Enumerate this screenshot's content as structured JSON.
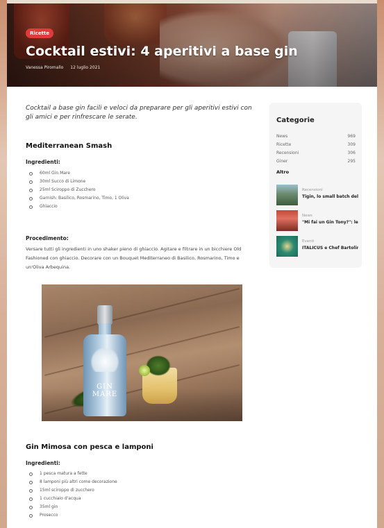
{
  "hero": {
    "tag": "Ricette",
    "title": "Cocktail estivi: 4 aperitivi a base gin",
    "author": "Vanessa Piromallo",
    "date": "12 luglio 2021"
  },
  "article": {
    "intro": "Cocktail a base gin facili e veloci da preparare per gli aperitivi estivi con gli amici e per rinfrescare le serate.",
    "recipes": [
      {
        "title": "Mediterranean Smash",
        "ingredients_label": "Ingredienti:",
        "ingredients": [
          "60ml Gin Mare",
          "30ml Succo di Limone",
          "25ml Sciroppo di Zucchero",
          "Garnish: Basilico, Rosmarino, Timo, 1 Oliva",
          "Ghiaccio"
        ],
        "procedure_label": "Procedimento:",
        "procedure": "Versare tutti gli ingredienti in uno shaker pieno di ghiaccio. Agitare e filtrare in un bicchiere Old Fashioned con ghiaccio. Decorare con un Bouquet Mediterraneo di Basilico, Rosmarino, Timo e un'Oliva Arbequina."
      },
      {
        "title": "Gin Mimosa con pesca e lamponi",
        "ingredients_label": "Ingredienti:",
        "ingredients": [
          "1 pesca matura a fette",
          "8 lamponi più altri come decorazione",
          "15ml sciroppo di zucchero",
          "1 cucchiaio d'acqua",
          "35ml gin",
          "Prosecco"
        ]
      }
    ],
    "photo_label": "GIN MARE"
  },
  "sidebar": {
    "title": "Categorie",
    "categories": [
      {
        "name": "News",
        "count": "969"
      },
      {
        "name": "Ricette",
        "count": "309"
      },
      {
        "name": "Recensioni",
        "count": "306"
      },
      {
        "name": "Giner",
        "count": "295"
      }
    ],
    "more": "Altro",
    "posts": [
      {
        "category": "Recensioni",
        "title": "Tigin, lo small batch del"
      },
      {
        "category": "News",
        "title": "\"Mi fai un Gin Tony?\": le"
      },
      {
        "category": "Eventi",
        "title": "ITALICUS e Chef Bartolin"
      }
    ]
  },
  "colors": {
    "tag": "#e03b3b",
    "sidebar_bg": "#f5f5f5"
  }
}
